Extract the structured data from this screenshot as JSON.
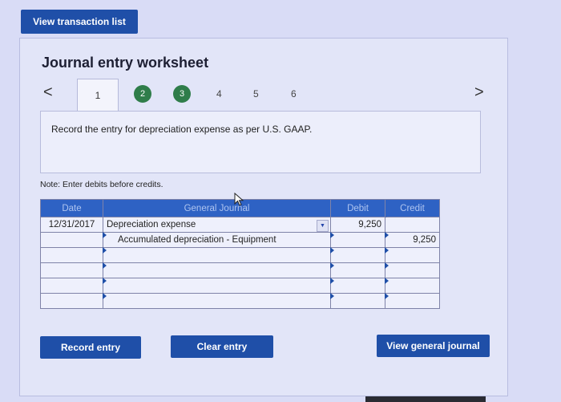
{
  "top": {
    "view_transactions_label": "View transaction list"
  },
  "worksheet": {
    "title": "Journal entry worksheet",
    "nav_prev": "<",
    "nav_next": ">",
    "tabs": [
      {
        "label": "1",
        "state": "active"
      },
      {
        "label": "2",
        "state": "complete"
      },
      {
        "label": "3",
        "state": "complete"
      },
      {
        "label": "4",
        "state": "plain"
      },
      {
        "label": "5",
        "state": "plain"
      },
      {
        "label": "6",
        "state": "plain"
      }
    ],
    "instruction": "Record the entry for depreciation expense as per U.S. GAAP.",
    "note": "Note: Enter debits before credits."
  },
  "journal": {
    "headers": {
      "date": "Date",
      "account": "General Journal",
      "debit": "Debit",
      "credit": "Credit"
    },
    "rows": [
      {
        "date": "12/31/2017",
        "account": "Depreciation expense",
        "debit": "9,250",
        "credit": ""
      },
      {
        "date": "",
        "account": "Accumulated depreciation - Equipment",
        "debit": "",
        "credit": "9,250"
      },
      {
        "date": "",
        "account": "",
        "debit": "",
        "credit": ""
      },
      {
        "date": "",
        "account": "",
        "debit": "",
        "credit": ""
      },
      {
        "date": "",
        "account": "",
        "debit": "",
        "credit": ""
      },
      {
        "date": "",
        "account": "",
        "debit": "",
        "credit": ""
      }
    ]
  },
  "buttons": {
    "record": "Record entry",
    "clear": "Clear entry",
    "view_journal": "View general journal"
  },
  "colors": {
    "button_blue": "#1f4fa8",
    "header_blue": "#2e62c4",
    "tab_green": "#2f7d4a"
  }
}
